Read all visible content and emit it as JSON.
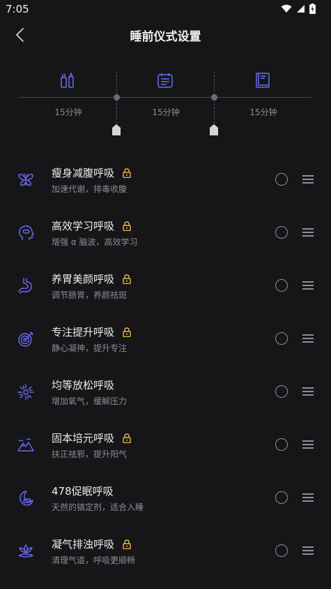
{
  "status": {
    "time": "7:05"
  },
  "header": {
    "title": "睡前仪式设置"
  },
  "timeline": {
    "segments": [
      {
        "icon": "toothbrush-cup-icon",
        "duration": "15分钟"
      },
      {
        "icon": "calendar-list-icon",
        "duration": "15分钟"
      },
      {
        "icon": "book-icon",
        "duration": "15分钟"
      }
    ]
  },
  "items": [
    {
      "title": "瘦身减腹呼吸",
      "subtitle": "加速代谢，排毒收腹",
      "icon": "butterfly-icon",
      "locked": true
    },
    {
      "title": "高效学习呼吸",
      "subtitle": "增强 α 脑波，高效学习",
      "icon": "head-brain-icon",
      "locked": true
    },
    {
      "title": "养胃美颜呼吸",
      "subtitle": "调节肠胃，养颜祛斑",
      "icon": "stomach-icon",
      "locked": true
    },
    {
      "title": "专注提升呼吸",
      "subtitle": "静心凝神，提升专注",
      "icon": "target-icon",
      "locked": true
    },
    {
      "title": "均等放松呼吸",
      "subtitle": "增加氧气，缓解压力",
      "icon": "burst-icon",
      "locked": false
    },
    {
      "title": "固本培元呼吸",
      "subtitle": "扶正祛邪，提升阳气",
      "icon": "mountain-icon",
      "locked": true
    },
    {
      "title": "478促眠呼吸",
      "subtitle": "天然的镇定剂，适合入睡",
      "icon": "moon-cloud-icon",
      "locked": false
    },
    {
      "title": "凝气排浊呼吸",
      "subtitle": "清理气道，呼吸更顺畅",
      "icon": "lotus-icon",
      "locked": true
    }
  ],
  "colors": {
    "background": "#161619",
    "accent": "#6b6cf2",
    "lock": "#e6b84a",
    "muted": "#8b8b94"
  }
}
